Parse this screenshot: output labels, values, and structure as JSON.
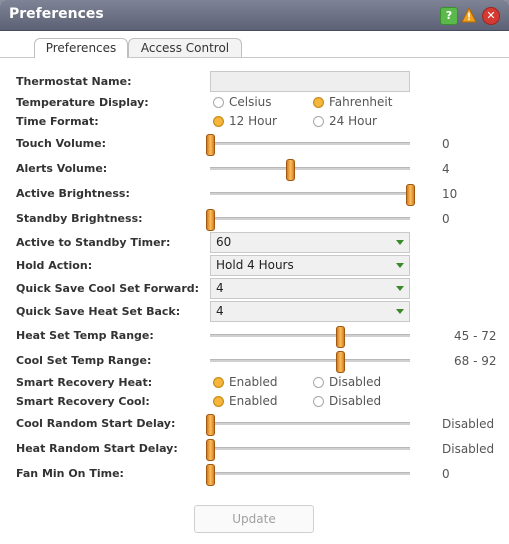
{
  "window": {
    "title": "Preferences"
  },
  "titlebar_icons": [
    "help-icon",
    "warning-icon",
    "close-icon"
  ],
  "tabs": [
    {
      "label": "Preferences",
      "active": true
    },
    {
      "label": "Access Control",
      "active": false
    }
  ],
  "form": {
    "thermostat_name": {
      "label": "Thermostat Name:",
      "value": ""
    },
    "temperature_display": {
      "label": "Temperature Display:",
      "options": [
        "Celsius",
        "Fahrenheit"
      ],
      "selected": "Fahrenheit"
    },
    "time_format": {
      "label": "Time Format:",
      "options": [
        "12 Hour",
        "24 Hour"
      ],
      "selected": "12 Hour"
    },
    "touch_volume": {
      "label": "Touch Volume:",
      "value": "0",
      "level": 0.0
    },
    "alerts_volume": {
      "label": "Alerts Volume:",
      "value": "4",
      "level": 0.4
    },
    "active_brightness": {
      "label": "Active Brightness:",
      "value": "10",
      "level": 1.0
    },
    "standby_brightness": {
      "label": "Standby Brightness:",
      "value": "0",
      "level": 0.0
    },
    "active_to_standby_timer": {
      "label": "Active to Standby Timer:",
      "value": "60"
    },
    "hold_action": {
      "label": "Hold Action:",
      "value": "Hold 4 Hours"
    },
    "quick_save_cool": {
      "label": "Quick Save Cool Set Forward:",
      "value": "4"
    },
    "quick_save_heat": {
      "label": "Quick Save Heat Set Back:",
      "value": "4"
    },
    "heat_set_temp_range": {
      "label": "Heat Set Temp Range:",
      "value": "45 - 72",
      "level": 0.65
    },
    "cool_set_temp_range": {
      "label": "Cool Set Temp Range:",
      "value": "68 - 92",
      "level": 0.65
    },
    "smart_recovery_heat": {
      "label": "Smart Recovery Heat:",
      "options": [
        "Enabled",
        "Disabled"
      ],
      "selected": "Enabled"
    },
    "smart_recovery_cool": {
      "label": "Smart Recovery Cool:",
      "options": [
        "Enabled",
        "Disabled"
      ],
      "selected": "Enabled"
    },
    "cool_random_start_delay": {
      "label": "Cool Random Start Delay:",
      "value": "Disabled",
      "level": 0.0
    },
    "heat_random_start_delay": {
      "label": "Heat Random Start Delay:",
      "value": "Disabled",
      "level": 0.0
    },
    "fan_min_on_time": {
      "label": "Fan Min On Time:",
      "value": "0",
      "level": 0.0
    }
  },
  "update_button": {
    "label": "Update",
    "enabled": false
  },
  "colors": {
    "accent": "#f5b63c",
    "titlebar": "#6b7083",
    "arrow": "#3a8a2a"
  }
}
